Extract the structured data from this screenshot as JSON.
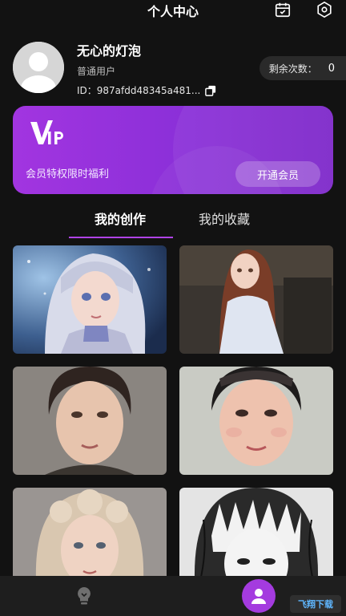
{
  "header": {
    "title": "个人中心",
    "icons": [
      "calendar-icon",
      "settings-icon"
    ]
  },
  "profile": {
    "name": "无心的灯泡",
    "user_type": "普通用户",
    "id_text": "ID：987afdd48345a481...",
    "remaining_label": "剩余次数：",
    "remaining_count": "0"
  },
  "vip": {
    "logo": "VIP",
    "tagline": "会员特权限时福利",
    "button": "开通会员"
  },
  "tabs": [
    {
      "label": "我的创作",
      "active": true
    },
    {
      "label": "我的收藏",
      "active": false
    }
  ],
  "gallery": [
    {
      "subject": "anime girl with silver hair and blue eyes"
    },
    {
      "subject": "anime girl with long brown hair in white blouse"
    },
    {
      "subject": "portrait of woman with dark curly updo"
    },
    {
      "subject": "portrait of woman with dark lace headband"
    },
    {
      "subject": "portrait of woman with blonde curly hair"
    },
    {
      "subject": "black and white manga style girl"
    }
  ],
  "nav": {
    "items": [
      "lightbulb-icon",
      "user-icon"
    ],
    "active": "user-icon"
  },
  "colors": {
    "accent": "#a43bdf",
    "background": "#121212",
    "vip_gradient_start": "#a235e0",
    "vip_gradient_end": "#7d27c9"
  },
  "watermark": "飞翔下载"
}
